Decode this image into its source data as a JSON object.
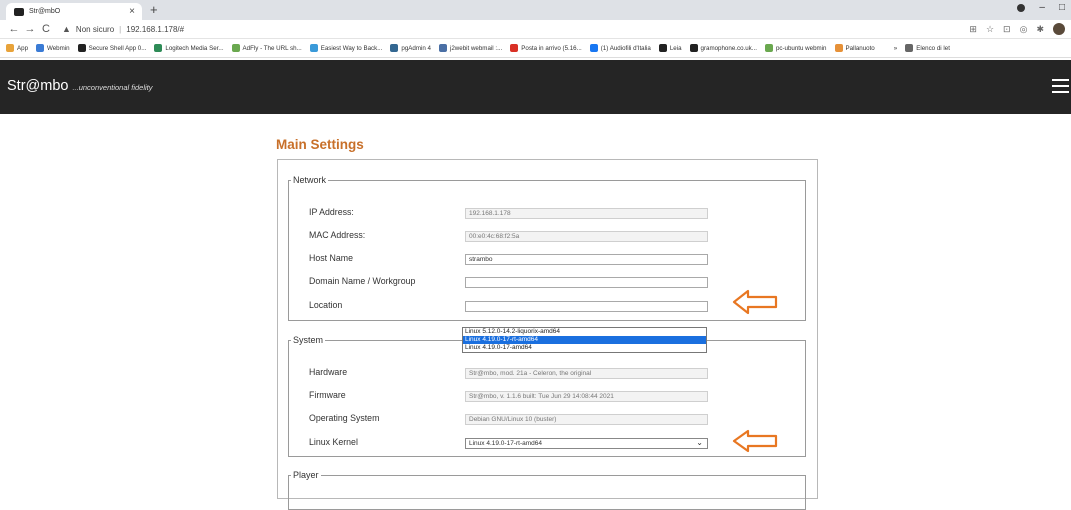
{
  "browser": {
    "tab_title": "Str@mbO",
    "tab_close": "×",
    "new_tab": "+",
    "security_label": "Non sicuro",
    "url": "192.168.1.178/#",
    "bookmarks": [
      {
        "label": "App",
        "color": "#e8a33a"
      },
      {
        "label": "Webmin",
        "color": "#3a7bd5"
      },
      {
        "label": "Secure Shell App 0...",
        "color": "#222222"
      },
      {
        "label": "Logitech Media Ser...",
        "color": "#2e8b57"
      },
      {
        "label": "AdFly - The URL sh...",
        "color": "#6aa84f"
      },
      {
        "label": "Easiest Way to Back...",
        "color": "#3a9ad9"
      },
      {
        "label": "pgAdmin 4",
        "color": "#336791"
      },
      {
        "label": "j2webit webmail :...",
        "color": "#4a6fa5"
      },
      {
        "label": "Posta in arrivo (5.16...",
        "color": "#d93025"
      },
      {
        "label": "(1) Audiofili d'Italia",
        "color": "#1877f2"
      },
      {
        "label": "Leia",
        "color": "#222222"
      },
      {
        "label": "gramophone.co.uk...",
        "color": "#222222"
      },
      {
        "label": "pc-ubuntu webmin",
        "color": "#6aa84f"
      },
      {
        "label": "Pallanuoto",
        "color": "#e69138"
      },
      {
        "label": "»",
        "color": "#ffffff"
      },
      {
        "label": "Elenco di let",
        "color": "#666666"
      }
    ]
  },
  "app": {
    "brand": "Str@mbo",
    "tagline": "...unconventional fidelity",
    "page_title": "Main Settings",
    "accent_color": "#c8702a"
  },
  "network": {
    "legend": "Network",
    "ip_label": "IP Address:",
    "ip_value": "192.168.1.178",
    "mac_label": "MAC Address:",
    "mac_value": "00:e0:4c:68:f2:5a",
    "host_label": "Host Name",
    "host_value": "strambo",
    "domain_label": "Domain Name / Workgroup",
    "domain_value": "",
    "location_label": "Location",
    "location_value": ""
  },
  "system": {
    "legend": "System",
    "hardware_label": "Hardware",
    "hardware_value": "Str@mbo, mod. 21a - Celeron, the original",
    "firmware_label": "Firmware",
    "firmware_value": "Str@mbo, v. 1.1.6 built: Tue Jun 29 14:08:44 2021",
    "os_label": "Operating System",
    "os_value": "Debian GNU/Linux 10 (buster)",
    "kernel_label": "Linux Kernel",
    "kernel_value": "Linux 4.19.0-17-rt-amd64",
    "kernel_options": [
      "Linux 5.12.0-14.2-liquorix-amd64",
      "Linux 4.19.0-17-rt-amd64",
      "Linux 4.19.0-17-amd64"
    ],
    "kernel_selected_index": 1
  },
  "player": {
    "legend": "Player"
  },
  "annotation_color": "#e87722"
}
